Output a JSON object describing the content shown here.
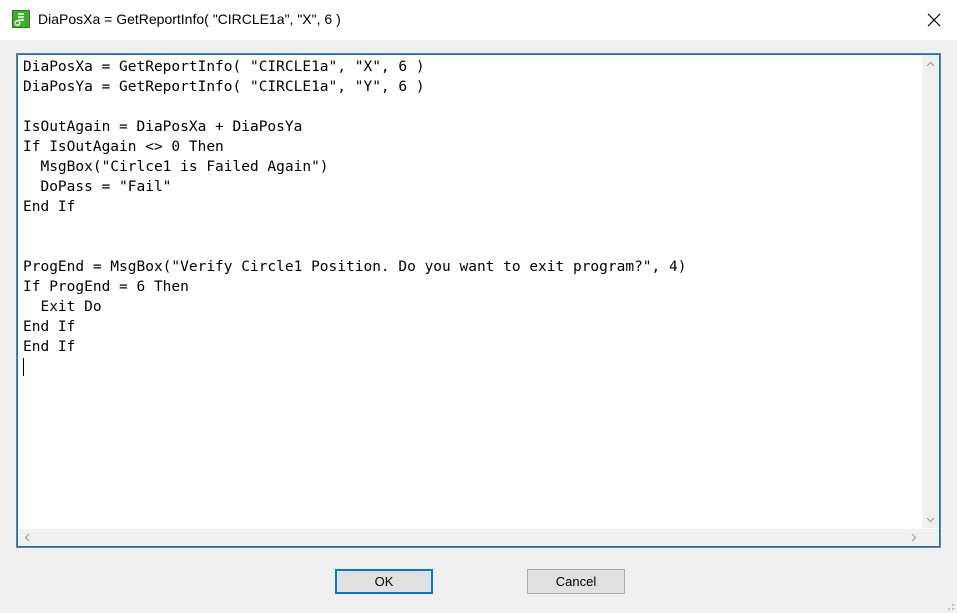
{
  "window": {
    "title": "DiaPosXa = GetReportInfo( \"CIRCLE1a\", \"X\", 6 )"
  },
  "editor": {
    "code": "DiaPosXa = GetReportInfo( \"CIRCLE1a\", \"X\", 6 )\nDiaPosYa = GetReportInfo( \"CIRCLE1a\", \"Y\", 6 )\n\nIsOutAgain = DiaPosXa + DiaPosYa\nIf IsOutAgain <> 0 Then\n  MsgBox(\"Cirlce1 is Failed Again\")\n  DoPass = \"Fail\"\nEnd If\n\n\nProgEnd = MsgBox(\"Verify Circle1 Position. Do you want to exit program?\", 4)\nIf ProgEnd = 6 Then\n  Exit Do\nEnd If\nEnd If"
  },
  "buttons": {
    "ok_label": "OK",
    "cancel_label": "Cancel"
  },
  "icons": {
    "app": "script-app-icon",
    "close": "close-icon"
  },
  "colors": {
    "accent": "#0078d7",
    "app_icon": "#3fae2a"
  }
}
